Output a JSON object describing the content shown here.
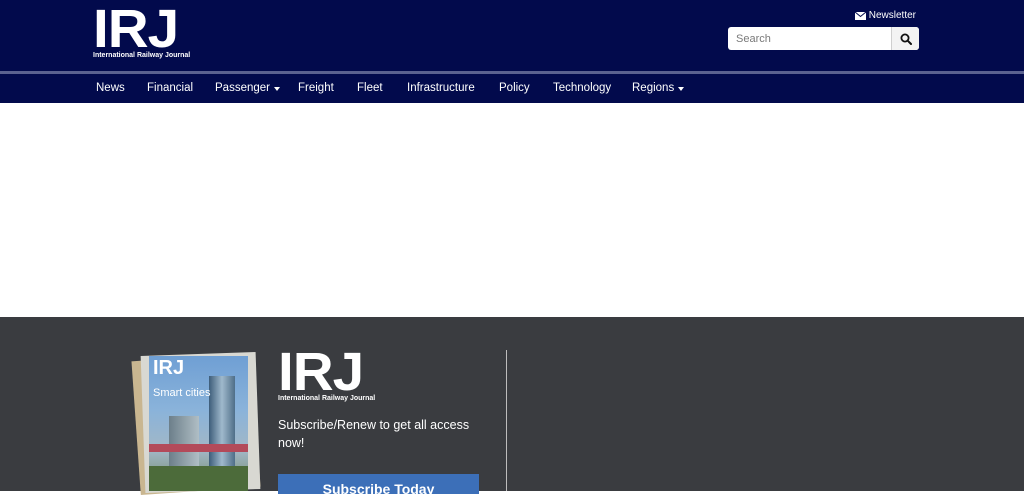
{
  "header": {
    "logo_letters": "IRJ",
    "logo_subtitle": "International Railway Journal",
    "newsletter_label": "Newsletter",
    "search_placeholder": "Search"
  },
  "nav": {
    "items": [
      {
        "label": "News",
        "dropdown": false
      },
      {
        "label": "Financial",
        "dropdown": false
      },
      {
        "label": "Passenger",
        "dropdown": true
      },
      {
        "label": "Freight",
        "dropdown": false
      },
      {
        "label": "Fleet",
        "dropdown": false
      },
      {
        "label": "Infrastructure",
        "dropdown": false
      },
      {
        "label": "Policy",
        "dropdown": false
      },
      {
        "label": "Technology",
        "dropdown": false
      },
      {
        "label": "Regions",
        "dropdown": true
      }
    ]
  },
  "footer": {
    "magazine_logo": "IRJ",
    "magazine_headline": "Smart cities",
    "logo_letters": "IRJ",
    "logo_subtitle": "International Railway Journal",
    "subscribe_text": "Subscribe/Renew to get all access now!",
    "subscribe_button": "Subscribe Today"
  },
  "colors": {
    "header_bg": "#020a4c",
    "footer_bg": "#3a3c40",
    "button_bg": "#3c6fb8"
  },
  "icons": {
    "newsletter": "envelope-icon",
    "search": "search-icon",
    "dropdown": "caret-down-icon"
  }
}
